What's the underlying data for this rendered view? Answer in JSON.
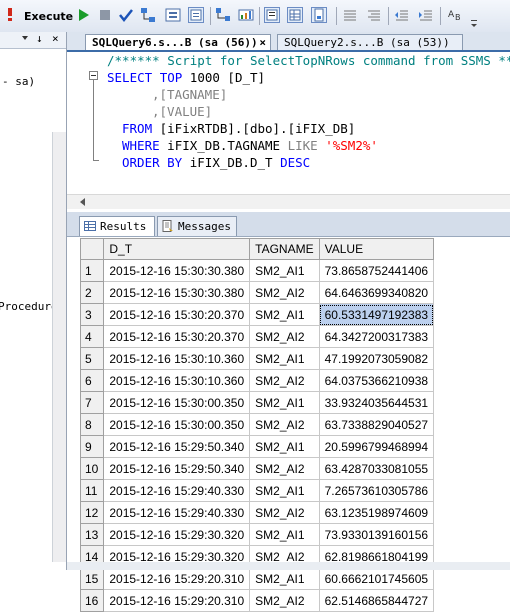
{
  "toolbar": {
    "execute_label": "Execute",
    "icons": [
      "execute-exclamation-icon",
      "run-icon",
      "stop-icon",
      "parse-check-icon",
      "display-plan-icon",
      "query-options-icon",
      "intellisense-icon",
      "include-plan-icon",
      "client-stats-icon",
      "results-text-icon",
      "results-grid-icon",
      "results-file-icon",
      "comment-icon",
      "uncomment-icon",
      "decrease-indent-icon",
      "increase-indent-icon",
      "specify-values-icon"
    ]
  },
  "left_panel": {
    "pin": "↓",
    "close": "×",
    "item_user": "- sa)",
    "item_procedures": "Procedure"
  },
  "tabs": [
    {
      "label": "SQLQuery6.s...B (sa (56))",
      "close": "×"
    },
    {
      "label": "SQLQuery2.s...B (sa (53))"
    }
  ],
  "editor": {
    "line1": "/****** Script for SelectTopNRows command from SSMS ******/",
    "kw_select": "SELECT",
    "kw_top": "TOP",
    "top_n": " 1000 [D_T]",
    "line3": ",[TAGNAME]",
    "line4": ",[VALUE]",
    "kw_from": "FROM",
    "from_obj": " [iFixRTDB].[dbo].[iFIX_DB]",
    "kw_where": "WHERE",
    "where_col": " iFIX_DB.TAGNAME ",
    "kw_like": "LIKE",
    "where_str": "'%SM2%'",
    "kw_order": "ORDER BY",
    "order_col": " iFIX_DB.D_T ",
    "kw_desc": "DESC"
  },
  "results": {
    "tab_results": "Results",
    "tab_messages": "Messages",
    "columns": [
      "D_T",
      "TAGNAME",
      "VALUE"
    ],
    "selected_cell": {
      "row": 3,
      "col": "VALUE"
    },
    "rows": [
      [
        "1",
        "2015-12-16 15:30:30.380",
        "SM2_AI1",
        "73.8658752441406"
      ],
      [
        "2",
        "2015-12-16 15:30:30.380",
        "SM2_AI2",
        "64.6463699340820"
      ],
      [
        "3",
        "2015-12-16 15:30:20.370",
        "SM2_AI1",
        "60.5331497192383"
      ],
      [
        "4",
        "2015-12-16 15:30:20.370",
        "SM2_AI2",
        "64.3427200317383"
      ],
      [
        "5",
        "2015-12-16 15:30:10.360",
        "SM2_AI1",
        "47.1992073059082"
      ],
      [
        "6",
        "2015-12-16 15:30:10.360",
        "SM2_AI2",
        "64.0375366210938"
      ],
      [
        "7",
        "2015-12-16 15:30:00.350",
        "SM2_AI1",
        "33.9324035644531"
      ],
      [
        "8",
        "2015-12-16 15:30:00.350",
        "SM2_AI2",
        "63.7338829040527"
      ],
      [
        "9",
        "2015-12-16 15:29:50.340",
        "SM2_AI1",
        "20.5996799468994"
      ],
      [
        "10",
        "2015-12-16 15:29:50.340",
        "SM2_AI2",
        "63.4287033081055"
      ],
      [
        "11",
        "2015-12-16 15:29:40.330",
        "SM2_AI1",
        "7.26573610305786"
      ],
      [
        "12",
        "2015-12-16 15:29:40.330",
        "SM2_AI2",
        "63.1235198974609"
      ],
      [
        "13",
        "2015-12-16 15:29:30.320",
        "SM2_AI1",
        "73.9330139160156"
      ],
      [
        "14",
        "2015-12-16 15:29:30.320",
        "SM2_AI2",
        "62.8198661804199"
      ],
      [
        "15",
        "2015-12-16 15:29:20.310",
        "SM2_AI1",
        "60.6662101745605"
      ],
      [
        "16",
        "2015-12-16 15:29:20.310",
        "SM2_AI2",
        "62.5146865844727"
      ]
    ]
  }
}
